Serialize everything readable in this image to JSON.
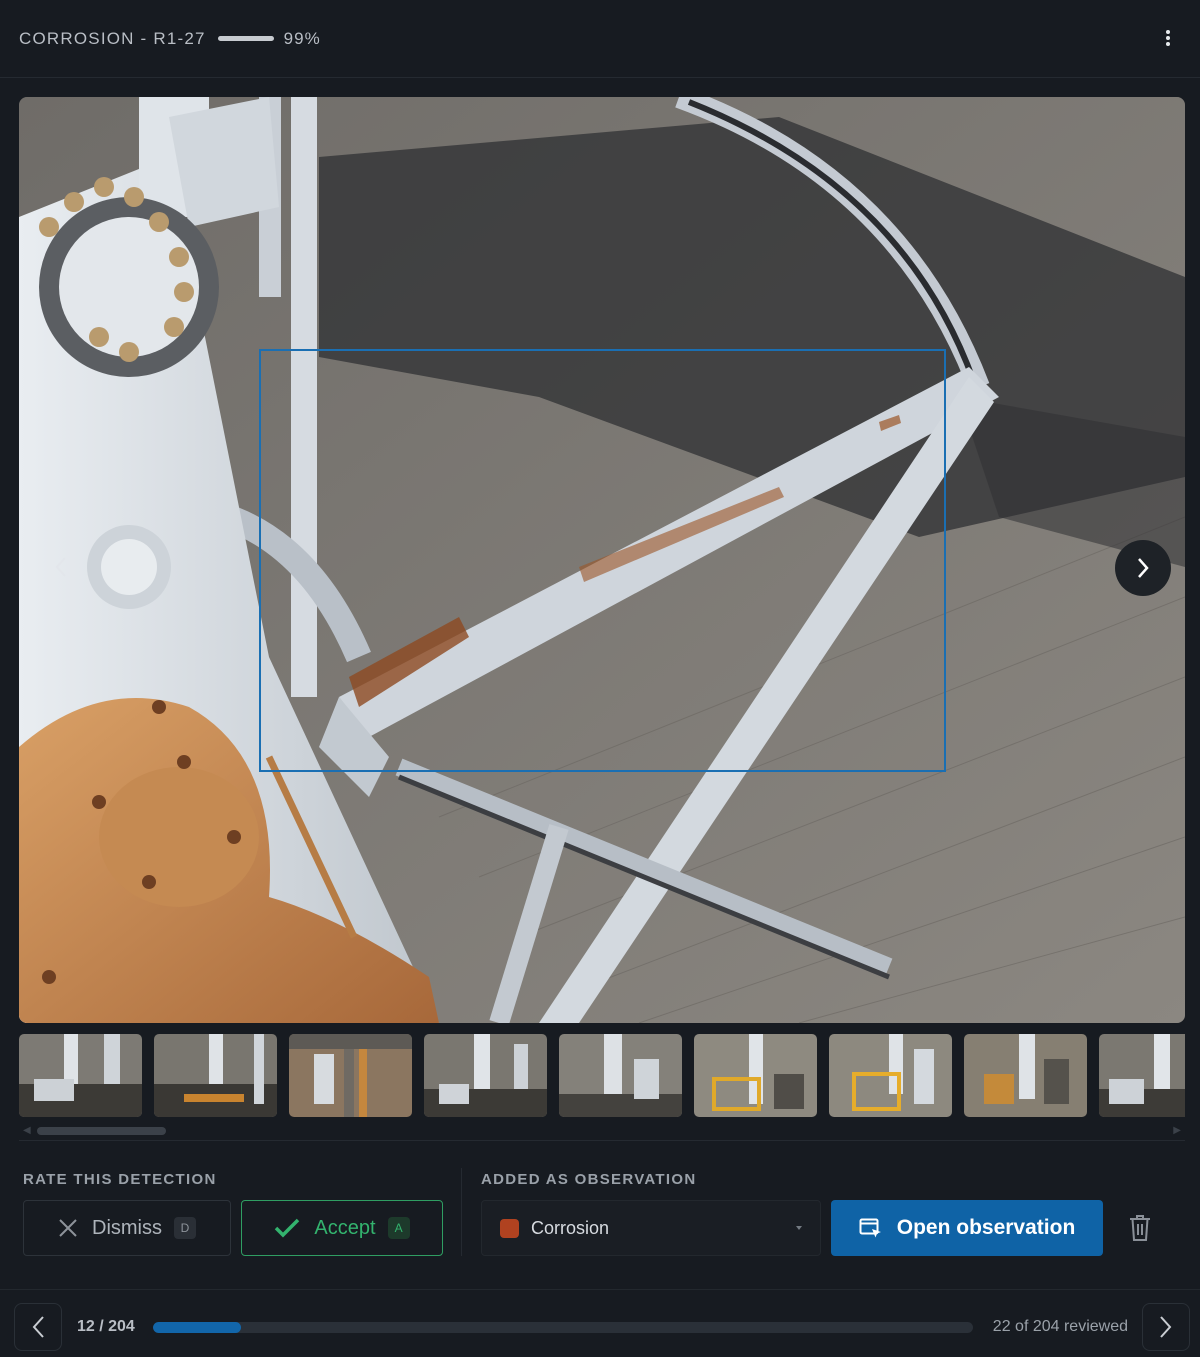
{
  "header": {
    "title": "CORROSION - R1-27",
    "confidence_label": "99%",
    "confidence_value": 0.99
  },
  "viewer": {
    "icons": {
      "prev": "chevron-left-icon",
      "next": "chevron-right-icon"
    }
  },
  "thumbnails": {
    "count": 9
  },
  "rating": {
    "section_label": "RATE THIS DETECTION",
    "dismiss_label": "Dismiss",
    "dismiss_key": "D",
    "accept_label": "Accept",
    "accept_key": "A"
  },
  "observation": {
    "section_label": "ADDED AS OBSERVATION",
    "type_label": "Corrosion",
    "type_color": "#b04220",
    "open_label": "Open observation"
  },
  "footer": {
    "counter": "12 / 204",
    "reviewed": "22 of 204 reviewed",
    "reviewed_count": 22,
    "total": 204
  },
  "colors": {
    "accent": "#0f63a6",
    "accept": "#33b36e",
    "bbox": "#1a6fb3"
  }
}
